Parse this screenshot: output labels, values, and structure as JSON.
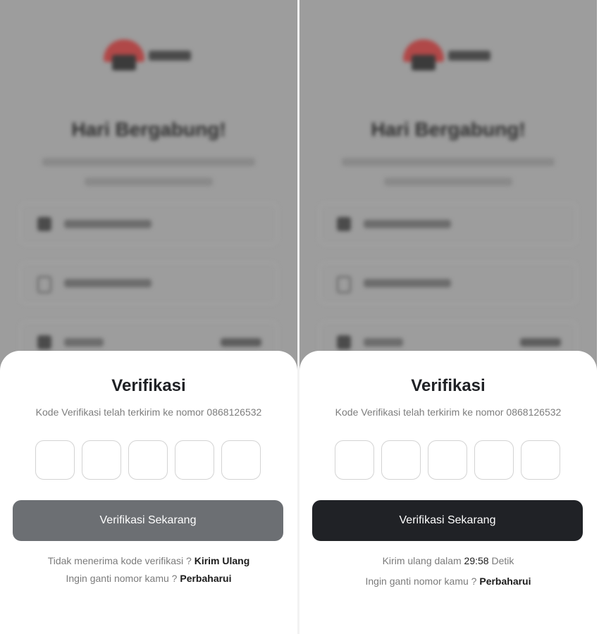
{
  "screens": [
    {
      "id": "before-resend",
      "background": {
        "title": "Hari Bergabung!"
      },
      "sheet": {
        "title": "Verifikasi",
        "subtitle": "Kode Verifikasi telah terkirim ke nomor 0868126532",
        "otp_count": 5,
        "button_label": "Verifikasi Sekarang",
        "button_state": "disabled",
        "line1_prefix": "Tidak menerima kode verifikasi ?",
        "line1_link": "Kirim Ulang",
        "line2_prefix": "Ingin ganti nomor kamu ?",
        "line2_link": "Perbaharui"
      }
    },
    {
      "id": "after-resend",
      "background": {
        "title": "Hari Bergabung!"
      },
      "sheet": {
        "title": "Verifikasi",
        "subtitle": "Kode Verifikasi telah terkirim ke nomor 0868126532",
        "otp_count": 5,
        "button_label": "Verifikasi Sekarang",
        "button_state": "active",
        "line1_prefix": "Kirim ulang dalam",
        "line1_timer": "29:58",
        "line1_suffix": "Detik",
        "line2_prefix": "Ingin ganti nomor kamu ?",
        "line2_link": "Perbaharui"
      }
    }
  ],
  "colors": {
    "overlay": "#9d9d9d",
    "button_disabled": "#6c6f73",
    "button_active": "#202226",
    "text_muted": "#7b7b7b",
    "text_strong": "#1b1b1b"
  }
}
